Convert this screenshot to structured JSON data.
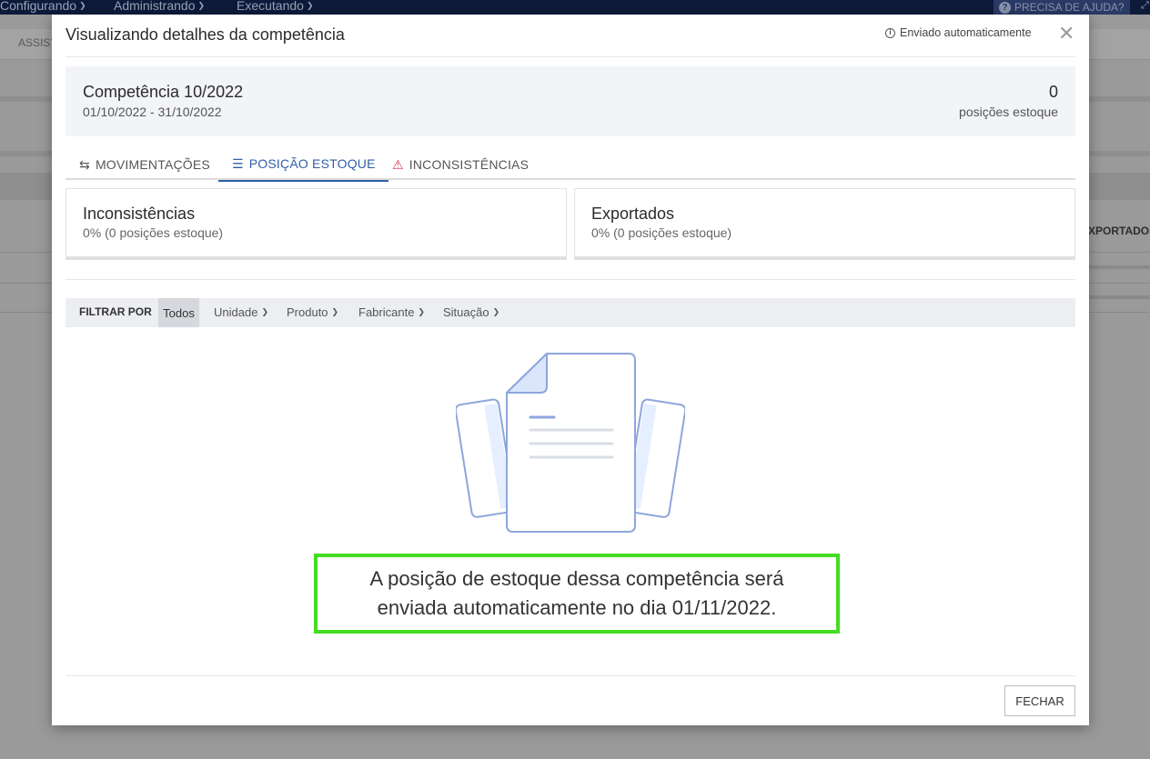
{
  "background": {
    "menu": [
      {
        "label": "Configurando"
      },
      {
        "label": "Administrando"
      },
      {
        "label": "Executando"
      }
    ],
    "help_label": "PRECISA DE AJUDA?",
    "sub_label": "ASSIST",
    "exportados_label": "XPORTADOS"
  },
  "modal": {
    "title": "Visualizando detalhes da competência",
    "auto_info": "Enviado automaticamente",
    "summary": {
      "title": "Competência 10/2022",
      "range": "01/10/2022 - 31/10/2022",
      "count": "0",
      "count_label": "posições estoque"
    },
    "tabs": [
      {
        "label": "MOVIMENTAÇÕES",
        "icon": "arrows-exchange-icon"
      },
      {
        "label": "POSIÇÃO ESTOQUE",
        "icon": "list-icon",
        "active": true
      },
      {
        "label": "INCONSISTÊNCIAS",
        "icon": "warning-icon"
      }
    ],
    "cards": [
      {
        "title": "Inconsistências",
        "sub": "0% (0 posições estoque)"
      },
      {
        "title": "Exportados",
        "sub": "0% (0 posições estoque)"
      }
    ],
    "filter": {
      "label": "FILTRAR POR",
      "todos": "Todos",
      "items": [
        "Unidade",
        "Produto",
        "Fabricante",
        "Situação"
      ]
    },
    "empty_message": "A posição de estoque dessa competência será enviada automaticamente no dia 01/11/2022.",
    "close_button": "FECHAR"
  },
  "colors": {
    "accent": "#2f5fa7",
    "warning": "#d9334a",
    "highlight_border": "#44dd22",
    "topbar": "#0e1a3a"
  }
}
